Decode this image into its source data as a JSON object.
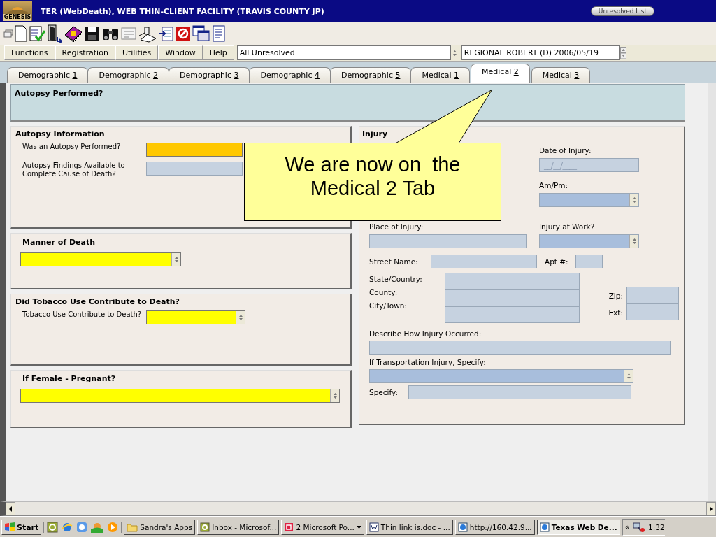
{
  "title_bar": {
    "logo_text": "GENESIS",
    "title": "TER (WebDeath), WEB THIN-CLIENT FACILITY (TRAVIS COUNTY JP)",
    "button": "Unresolved List"
  },
  "menu": [
    "Functions",
    "Registration",
    "Utilities",
    "Window",
    "Help"
  ],
  "filter_select": {
    "value": "All Unresolved"
  },
  "record_select": {
    "value": "REGIONAL ROBERT (D) 2006/05/19"
  },
  "tabs": [
    {
      "label": "Demographic 1",
      "selected": false
    },
    {
      "label": "Demographic 2",
      "selected": false
    },
    {
      "label": "Demographic 3",
      "selected": false
    },
    {
      "label": "Demographic 4",
      "selected": false
    },
    {
      "label": "Demographic 5",
      "selected": false
    },
    {
      "label": "Medical 1",
      "selected": false
    },
    {
      "label": "Medical 2",
      "selected": true
    },
    {
      "label": "Medical 3",
      "selected": false
    }
  ],
  "header_panel": {
    "title": "Autopsy Performed?"
  },
  "sections": [
    {
      "title": "Autopsy Information",
      "fields": [
        {
          "label": "Was an Autopsy Performed?",
          "kind": "text",
          "required": true,
          "focused": true
        },
        {
          "label": "Autopsy Findings Available to Complete Cause of Death?",
          "kind": "text",
          "required": false,
          "focused": false
        }
      ]
    },
    {
      "title": "Manner of Death",
      "fields": [
        {
          "kind": "select",
          "required": true,
          "focused": false
        }
      ]
    },
    {
      "title": "Did Tobacco Use Contribute to Death?",
      "fields": [
        {
          "label": "Tobacco Use Contribute to Death?",
          "kind": "select",
          "required": true,
          "focused": false
        }
      ]
    },
    {
      "title": "If Female - Pregnant?",
      "fields": [
        {
          "kind": "select",
          "required": true,
          "focused": false
        }
      ]
    }
  ],
  "injury": {
    "title": "Injury",
    "date_of_injury": {
      "label": "Date of Injury:",
      "kind": "text",
      "placeholder": "__/__/____"
    },
    "am_pm": {
      "label": "Am/Pm:",
      "kind": "select"
    },
    "place_of_injury": {
      "label": "Place of Injury:",
      "kind": "text"
    },
    "injury_at_work": {
      "label": "Injury at Work?",
      "kind": "select"
    },
    "street_name": {
      "label": "Street Name:",
      "kind": "text"
    },
    "apt": {
      "label": "Apt #:",
      "kind": "text"
    },
    "state_country": {
      "label": "State/Country:",
      "kind": "text"
    },
    "county": {
      "label": "County:",
      "kind": "text"
    },
    "city_town": {
      "label": "City/Town:",
      "kind": "text"
    },
    "zip": {
      "label": "Zip:",
      "kind": "text"
    },
    "ext": {
      "label": "Ext:",
      "kind": "text"
    },
    "describe": {
      "label": "Describe How Injury Occurred:",
      "kind": "text"
    },
    "transportation": {
      "label": "If Transportation Injury, Specify:",
      "kind": "select"
    },
    "specify": {
      "label": "Specify:",
      "kind": "text"
    }
  },
  "callout": {
    "lines": [
      "We are now on  the",
      "Medical 2 Tab"
    ]
  },
  "taskbar": {
    "start": "Start",
    "tasks": [
      {
        "label": "Sandra's Apps",
        "kind": "folder",
        "selected": false
      },
      {
        "label": "Inbox - Microsof...",
        "kind": "mail",
        "selected": false
      },
      {
        "label": "2 Microsoft Po...",
        "kind": "group",
        "selected": false
      },
      {
        "label": "Thin link is.doc - ...",
        "kind": "doc",
        "selected": false
      },
      {
        "label": "http://160.42.9...",
        "kind": "web",
        "selected": false
      },
      {
        "label": "Texas Web De...",
        "kind": "web",
        "selected": true
      }
    ],
    "tray_toggle": "«",
    "clock": "1:32"
  }
}
